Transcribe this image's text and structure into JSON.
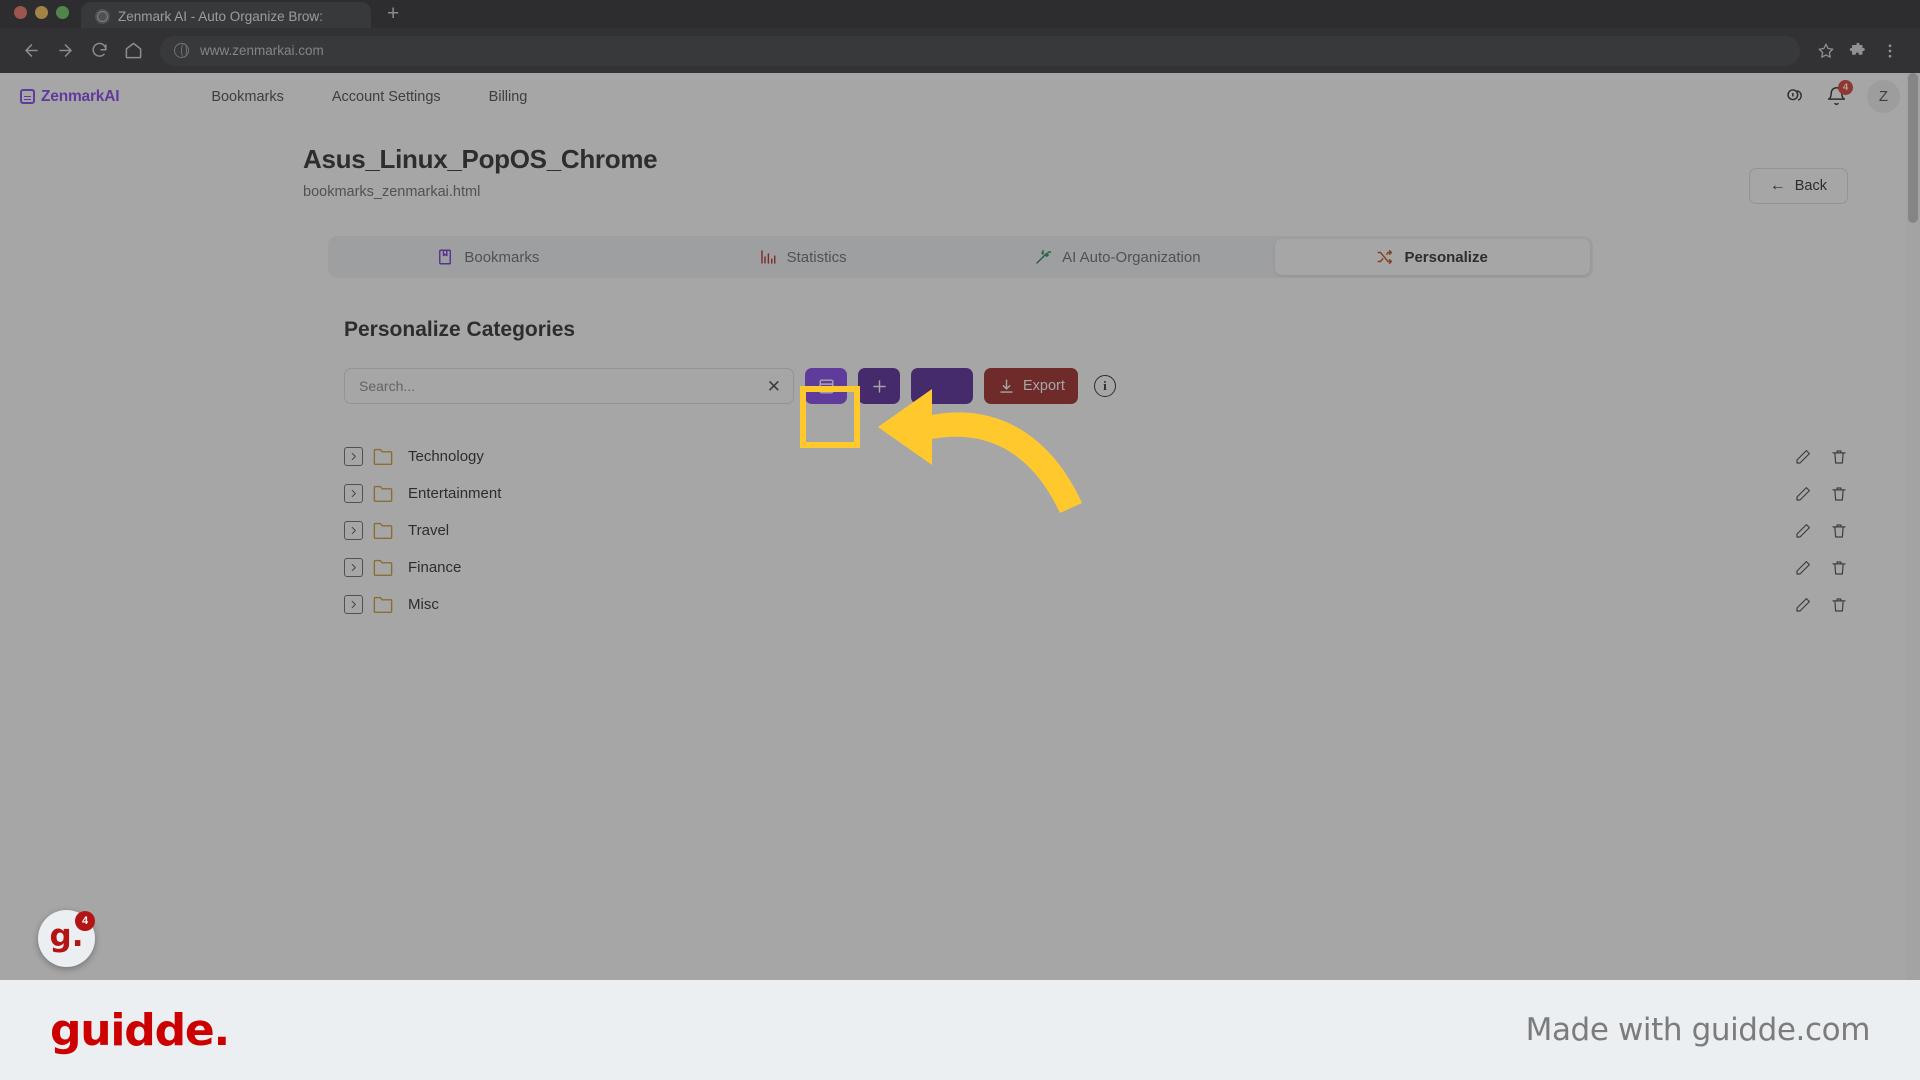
{
  "browser": {
    "tab_title": "Zenmark AI - Auto Organize Brow:",
    "new_tab_label": "+",
    "url": "www.zenmarkai.com",
    "back_icon": "back-arrow-icon",
    "forward_icon": "forward-arrow-icon",
    "reload_icon": "reload-icon",
    "home_icon": "home-icon",
    "star_icon": "bookmark-star-icon",
    "extensions_icon": "puzzle-piece-icon",
    "menu_icon": "kebab-menu-icon"
  },
  "app_header": {
    "brand": "ZenmarkAI",
    "nav": [
      {
        "label": "Bookmarks"
      },
      {
        "label": "Account Settings"
      },
      {
        "label": "Billing"
      }
    ],
    "credits_icon": "coins-icon",
    "notifications_icon": "bell-icon",
    "notification_count": "4",
    "avatar_initial": "Z"
  },
  "page": {
    "title": "Asus_Linux_PopOS_Chrome",
    "subtitle": "bookmarks_zenmarkai.html",
    "back_button": "Back",
    "back_arrow": "←"
  },
  "tabs": [
    {
      "label": "Bookmarks",
      "icon": "book-icon",
      "active": false
    },
    {
      "label": "Statistics",
      "icon": "bar-chart-icon",
      "active": false
    },
    {
      "label": "AI Auto-Organization",
      "icon": "magic-wand-icon",
      "active": false
    },
    {
      "label": "Personalize",
      "icon": "shuffle-icon",
      "active": true
    }
  ],
  "section": {
    "heading": "Personalize Categories"
  },
  "toolbar": {
    "search_placeholder": "Search...",
    "search_value": "",
    "clear_label": "✕",
    "collapse_button_icon": "collapse-all-icon",
    "purple_button_1_icon": "action-icon",
    "purple_button_2_label": "",
    "export_label": "Export",
    "export_icon": "download-icon",
    "info_label": "i",
    "colors": {
      "collapse": "#7c3aed",
      "purple_dark": "#4c1d95",
      "export": "#991b1b",
      "highlight": "#ffc92e"
    }
  },
  "categories": [
    {
      "name": "Technology",
      "expander_icon": "chevron-right-icon",
      "folder_icon": "folder-icon",
      "edit_icon": "pencil-icon",
      "delete_icon": "trash-icon"
    },
    {
      "name": "Entertainment",
      "expander_icon": "chevron-right-icon",
      "folder_icon": "folder-icon",
      "edit_icon": "pencil-icon",
      "delete_icon": "trash-icon"
    },
    {
      "name": "Travel",
      "expander_icon": "chevron-right-icon",
      "folder_icon": "folder-icon",
      "edit_icon": "pencil-icon",
      "delete_icon": "trash-icon"
    },
    {
      "name": "Finance",
      "expander_icon": "chevron-right-icon",
      "folder_icon": "folder-icon",
      "edit_icon": "pencil-icon",
      "delete_icon": "trash-icon"
    },
    {
      "name": "Misc",
      "expander_icon": "chevron-right-icon",
      "folder_icon": "folder-icon",
      "edit_icon": "pencil-icon",
      "delete_icon": "trash-icon"
    }
  ],
  "guidde": {
    "badge_letter": "g.",
    "badge_count": "4",
    "logo": "guidde.",
    "made_with": "Made with guidde.com"
  }
}
